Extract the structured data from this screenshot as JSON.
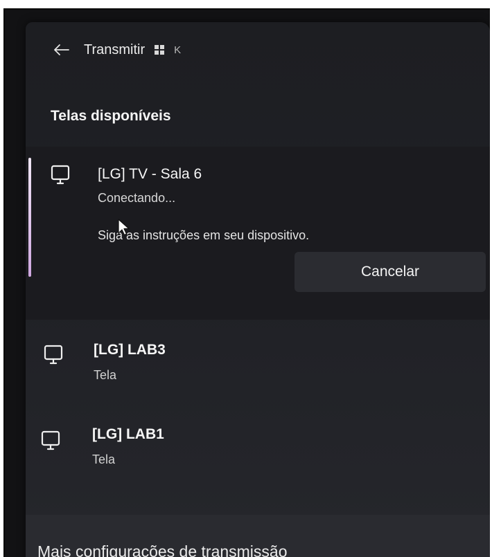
{
  "header": {
    "title": "Transmitir",
    "shortcut_key": "K",
    "back_icon": "arrow-left-icon",
    "windows_icon": "windows-logo-icon"
  },
  "section": {
    "title": "Telas disponíveis"
  },
  "devices": [
    {
      "name": "[LG] TV - Sala 6",
      "status": "Conectando...",
      "instructions": "Siga as instruções em seu dispositivo.",
      "action_label": "Cancelar",
      "selected": true,
      "icon": "monitor-icon"
    },
    {
      "name": "[LG] LAB3",
      "status": "Tela",
      "icon": "monitor-icon"
    },
    {
      "name": "[LG] LAB1",
      "status": "Tela",
      "icon": "monitor-icon"
    }
  ],
  "footer": {
    "link_label": "Mais configurações de transmissão"
  },
  "colors": {
    "panel_background": "#1f2024",
    "selection_accent": "#d9b8ea",
    "button_background": "#2b2c31",
    "footer_background": "#2a2b30"
  }
}
